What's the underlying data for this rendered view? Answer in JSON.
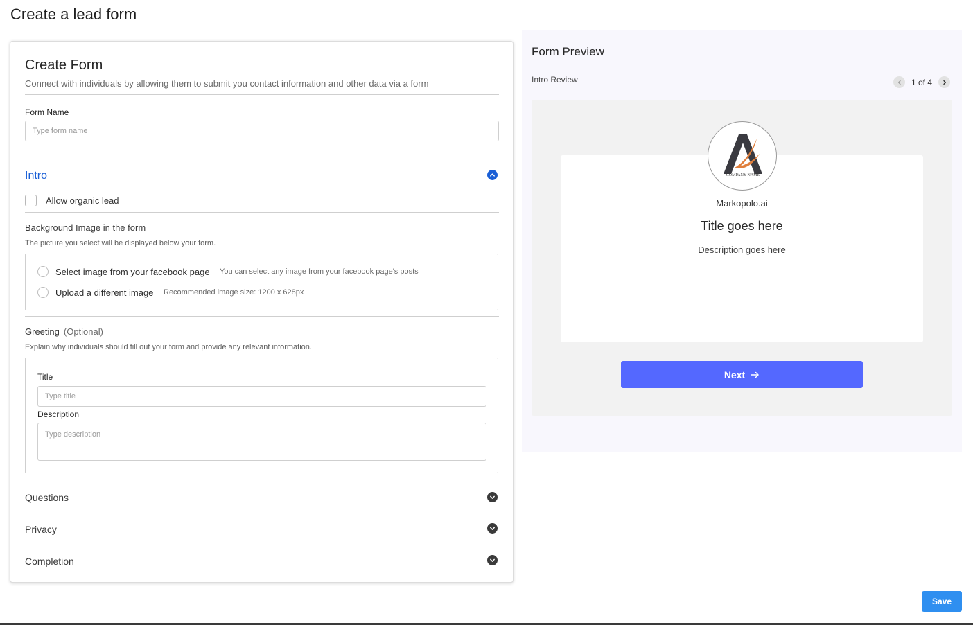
{
  "page": {
    "title": "Create a lead form"
  },
  "form": {
    "heading": "Create Form",
    "subtitle": "Connect with individuals by allowing them to submit you contact information and other data via a form",
    "form_name_label": "Form Name",
    "form_name_placeholder": "Type form name",
    "form_name_value": ""
  },
  "intro": {
    "title": "Intro",
    "allow_organic_label": "Allow organic lead",
    "allow_organic_checked": false,
    "background": {
      "label": "Background Image in the form",
      "helper": "The picture you select will be displayed below your form.",
      "options": [
        {
          "label": "Select image from your facebook page",
          "hint": "You can select any image from your facebook page's posts",
          "selected": false
        },
        {
          "label": "Upload a different image",
          "hint": "Recommended image size: 1200 x 628px",
          "selected": false
        }
      ]
    },
    "greeting": {
      "label": "Greeting",
      "optional": "(Optional)",
      "helper": "Explain why individuals should fill out your form and provide any relevant information.",
      "title_label": "Title",
      "title_placeholder": "Type title",
      "description_label": "Description",
      "description_placeholder": "Type description"
    }
  },
  "sections": [
    {
      "label": "Questions",
      "icon": "chevron-down-icon"
    },
    {
      "label": "Privacy",
      "icon": "chevron-down-icon"
    },
    {
      "label": "Completion",
      "icon": "chevron-down-icon"
    }
  ],
  "preview": {
    "title": "Form Preview",
    "step_label": "Intro Review",
    "pager_text": "1 of 4",
    "logo_text": "COMPANY NAME",
    "company": "Markopolo.ai",
    "card_title": "Title goes here",
    "card_description": "Description goes here",
    "next_label": "Next"
  },
  "actions": {
    "save_label": "Save"
  },
  "colors": {
    "accent_blue": "#1a5fd6",
    "next_button": "#5468ff",
    "save_button": "#2f8ff0",
    "preview_bg": "#f8f7fd"
  }
}
